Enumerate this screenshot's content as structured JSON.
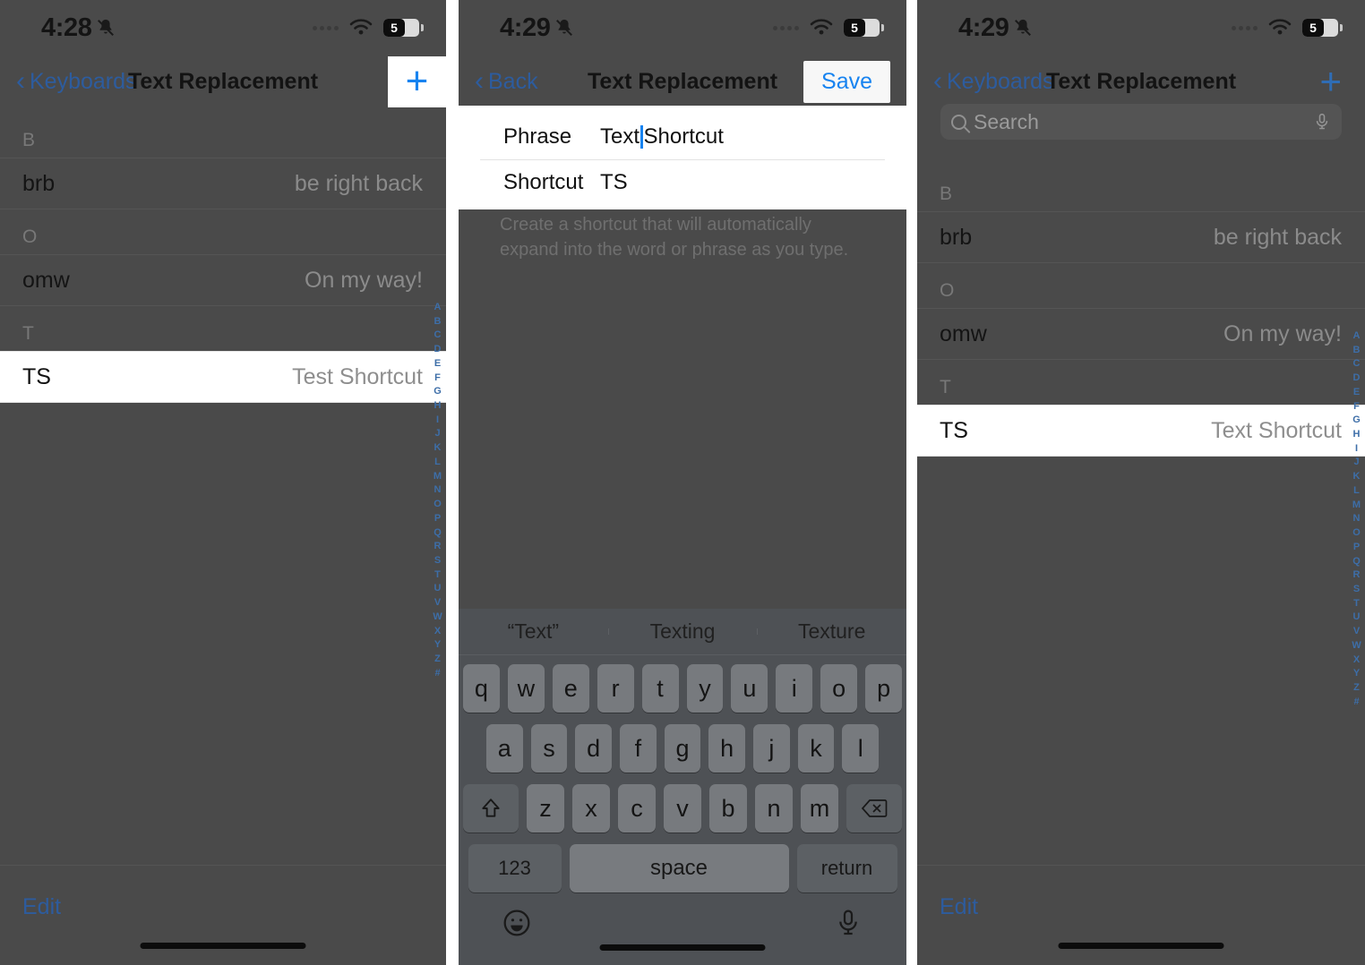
{
  "colors": {
    "dim_background": "#4a4a4a",
    "highlight": "#ffffff",
    "accent_blue": "#1783f0",
    "dimmed_blue": "#2d5c9e",
    "keyboard_bg": "#4e5155"
  },
  "panel1": {
    "status": {
      "time": "4:28",
      "bell_icon": "bell-slash-icon",
      "wifi_icon": "wifi-icon",
      "battery_level": "5",
      "signal_icon": "signal-dots-icon"
    },
    "nav": {
      "back_label": "Keyboards",
      "title": "Text Replacement",
      "add_icon": "plus-icon"
    },
    "sections": [
      {
        "header": "B",
        "rows": [
          {
            "shortcut": "brb",
            "phrase": "be right back",
            "highlighted": false
          }
        ]
      },
      {
        "header": "O",
        "rows": [
          {
            "shortcut": "omw",
            "phrase": "On my way!",
            "highlighted": false
          }
        ]
      },
      {
        "header": "T",
        "rows": [
          {
            "shortcut": "TS",
            "phrase": "Test Shortcut",
            "highlighted": true
          }
        ]
      }
    ],
    "index": [
      "A",
      "B",
      "C",
      "D",
      "E",
      "F",
      "G",
      "H",
      "I",
      "J",
      "K",
      "L",
      "M",
      "N",
      "O",
      "P",
      "Q",
      "R",
      "S",
      "T",
      "U",
      "V",
      "W",
      "X",
      "Y",
      "Z",
      "#"
    ],
    "footer": {
      "edit_label": "Edit"
    }
  },
  "panel2": {
    "status": {
      "time": "4:29",
      "bell_icon": "bell-slash-icon",
      "wifi_icon": "wifi-icon",
      "battery_level": "5",
      "signal_icon": "signal-dots-icon"
    },
    "nav": {
      "back_label": "Back",
      "title": "Text Replacement",
      "save_label": "Save"
    },
    "form": {
      "phrase_label": "Phrase",
      "phrase_value_before_caret": "Text",
      "phrase_value_after_caret": " Shortcut",
      "shortcut_label": "Shortcut",
      "shortcut_value": "TS"
    },
    "note": "Create a shortcut that will automatically expand into the word or phrase as you type.",
    "keyboard": {
      "predictions": [
        "“Text”",
        "Texting",
        "Texture"
      ],
      "row1": [
        "q",
        "w",
        "e",
        "r",
        "t",
        "y",
        "u",
        "i",
        "o",
        "p"
      ],
      "row2": [
        "a",
        "s",
        "d",
        "f",
        "g",
        "h",
        "j",
        "k",
        "l"
      ],
      "row3": [
        "z",
        "x",
        "c",
        "v",
        "b",
        "n",
        "m"
      ],
      "shift_icon": "shift-up-arrow-icon",
      "backspace_icon": "backspace-delete-icon",
      "numbers_label": "123",
      "space_label": "space",
      "return_label": "return",
      "emoji_icon": "emoji-smiley-icon",
      "dictation_icon": "microphone-icon"
    }
  },
  "panel3": {
    "status": {
      "time": "4:29",
      "bell_icon": "bell-slash-icon",
      "wifi_icon": "wifi-icon",
      "battery_level": "5",
      "signal_icon": "signal-dots-icon"
    },
    "nav": {
      "back_label": "Keyboards",
      "title": "Text Replacement",
      "add_icon": "plus-icon"
    },
    "search": {
      "placeholder": "Search",
      "search_icon": "magnifier-icon",
      "mic_icon": "microphone-icon"
    },
    "sections": [
      {
        "header": "B",
        "rows": [
          {
            "shortcut": "brb",
            "phrase": "be right back",
            "highlighted": false
          }
        ]
      },
      {
        "header": "O",
        "rows": [
          {
            "shortcut": "omw",
            "phrase": "On my way!",
            "highlighted": false
          }
        ]
      },
      {
        "header": "T",
        "rows": [
          {
            "shortcut": "TS",
            "phrase": "Text Shortcut",
            "highlighted": true
          }
        ]
      }
    ],
    "index": [
      "A",
      "B",
      "C",
      "D",
      "E",
      "F",
      "G",
      "H",
      "I",
      "J",
      "K",
      "L",
      "M",
      "N",
      "O",
      "P",
      "Q",
      "R",
      "S",
      "T",
      "U",
      "V",
      "W",
      "X",
      "Y",
      "Z",
      "#"
    ],
    "footer": {
      "edit_label": "Edit"
    }
  }
}
